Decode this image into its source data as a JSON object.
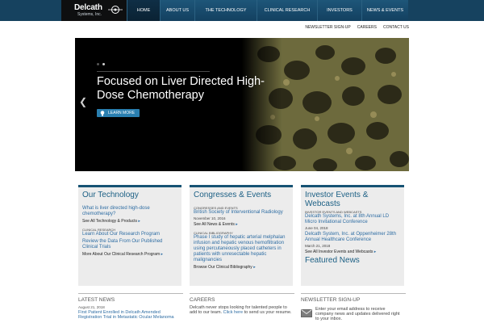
{
  "brand": {
    "name": "Delcath",
    "sub": "Systems, Inc."
  },
  "nav": [
    "HOME",
    "ABOUT US",
    "THE TECHNOLOGY",
    "CLINICAL RESEARCH",
    "INVESTORS",
    "NEWS & EVENTS"
  ],
  "util_links": [
    "NEWSLETTER SIGN-UP",
    "CAREERS",
    "CONTACT US"
  ],
  "hero": {
    "title": "Focused on Liver Directed High-Dose Chemotherapy",
    "button": "LEARN MORE"
  },
  "technology": {
    "title": "Our Technology",
    "link1": "What is liver directed high-dose chemotherapy?",
    "more1": "See All Technology & Products",
    "cat": "CLINICAL RESEARCH",
    "link2": "Learn About Our Research Program",
    "link3": "Review the Data From Our Published Clinical Trials",
    "more2": "More About Our Clinical Research Program"
  },
  "congresses": {
    "title": "Congresses & Events",
    "cat1": "CONGRESSES AND EVENTS",
    "link1": "British Society of Interventional Radiology",
    "date1": "November 10, 2016",
    "more1": "See All News & Events",
    "cat2": "CLINICAL BIBLIOGRAPHY",
    "link2": "Phase I study of hepatic arterial melphalan infusion and hepatic venous hemofiltration using percutaneously placed catheters in patients with unresectable hepatic malignancies",
    "more2": "Browse Our Clinical Bibliography"
  },
  "investors": {
    "title": "Investor Events & Webcasts",
    "cat": "INVESTOR EVENTS AND WEBCASTS",
    "link1": "Delcath Systems, Inc. at 8th Annual LD Micro Invitational Conference",
    "date1": "June 04, 2018",
    "link2": "Delcath System, Inc. at Oppenheimer 28th Annual Healthcare Conference",
    "date2": "March 21, 2018",
    "more": "See All Investor Events and Webcasts",
    "featured": "Featured News"
  },
  "latest_news": {
    "title": "LATEST NEWS",
    "date": "August 21, 2018",
    "link": "First Patient Enrolled in Delcath Amended Registration Trial in Metastatic Ocular Melanoma"
  },
  "careers": {
    "title": "CAREERS",
    "text_before": "Delcath never stops looking for talented people to add to our team.",
    "link": "Click here",
    "text_after": "to send us your resume."
  },
  "newsletter": {
    "title": "NEWSLETTER SIGN-UP",
    "text": "Enter your email address to receive company news and updates delivered right to your inbox."
  },
  "colors": {
    "nav_bg": "#16425f",
    "accent": "#175374",
    "link": "#2e6da3",
    "button": "#2a7fb0"
  }
}
